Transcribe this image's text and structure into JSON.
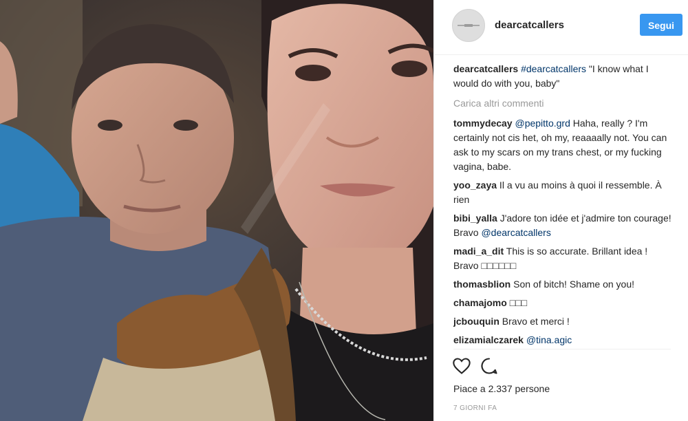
{
  "post": {
    "image_alt": "Selfie of a woman with a man standing behind her"
  },
  "header": {
    "username": "dearcatcallers",
    "follow_label": "Segui"
  },
  "caption": {
    "user": "dearcatcallers",
    "hashtag": "#dearcatcallers",
    "text": " \"I know what I would do with you, baby\""
  },
  "load_more_label": "Carica altri commenti",
  "comments": [
    {
      "user": "tommydecay",
      "mention": "@pepitto.grd",
      "text": " Haha, really ? I'm certainly not cis het, oh my, reaaaally not. You can ask to my scars on my trans chest, or my fucking vagina, babe."
    },
    {
      "user": "yoo_zaya",
      "mention": "",
      "text": " Il a vu au moins à quoi il ressemble. À rien"
    },
    {
      "user": "bibi_yalla",
      "mention": "",
      "text": " J'adore ton idée et j'admire ton courage! Bravo ",
      "mention_after": "@dearcatcallers"
    },
    {
      "user": "madi_a_dit",
      "mention": "",
      "text": " This is so accurate. Brillant idea ! Bravo □□□□□□"
    },
    {
      "user": "thomasblion",
      "mention": "",
      "text": " Son of bitch! Shame on you!"
    },
    {
      "user": "chamajomo",
      "mention": "",
      "text": " □□□"
    },
    {
      "user": "jcbouquin",
      "mention": "",
      "text": " Bravo et merci !"
    },
    {
      "user": "elizamialczarek",
      "mention": "@tina.agic",
      "text": ""
    }
  ],
  "likes_label": "Piace a 2.337 persone",
  "timestamp": "7 giorni fa",
  "icons": [
    "heart-icon",
    "comment-icon"
  ],
  "colors": {
    "accent": "#3897f0",
    "link": "#003569",
    "muted": "#999999"
  }
}
